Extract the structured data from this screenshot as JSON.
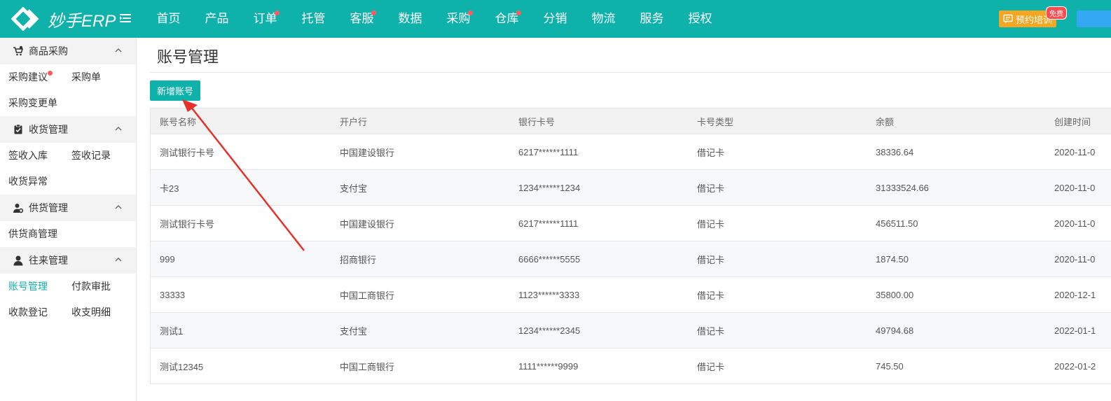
{
  "brand": {
    "name": "妙手ERP"
  },
  "nav": [
    {
      "label": "首页",
      "dot": false
    },
    {
      "label": "产品",
      "dot": false
    },
    {
      "label": "订单",
      "dot": true
    },
    {
      "label": "托管",
      "dot": false
    },
    {
      "label": "客服",
      "dot": true
    },
    {
      "label": "数据",
      "dot": false
    },
    {
      "label": "采购",
      "dot": true
    },
    {
      "label": "仓库",
      "dot": true
    },
    {
      "label": "分销",
      "dot": false
    },
    {
      "label": "物流",
      "dot": false
    },
    {
      "label": "服务",
      "dot": false
    },
    {
      "label": "授权",
      "dot": false
    }
  ],
  "topright": {
    "train_label": "预约培训",
    "free_badge": "免费"
  },
  "sidebar": {
    "sections": [
      {
        "title": "商品采购",
        "icon": "cart-icon",
        "links": [
          {
            "label": "采购建议",
            "dot": true
          },
          {
            "label": "采购单"
          },
          {
            "label": "采购变更单"
          }
        ]
      },
      {
        "title": "收货管理",
        "icon": "clipboard-check-icon",
        "links": [
          {
            "label": "签收入库"
          },
          {
            "label": "签收记录"
          },
          {
            "label": "收货异常"
          }
        ]
      },
      {
        "title": "供货管理",
        "icon": "user-gear-icon",
        "links": [
          {
            "label": "供货商管理"
          }
        ]
      },
      {
        "title": "往来管理",
        "icon": "user-icon",
        "links": [
          {
            "label": "账号管理",
            "active": true
          },
          {
            "label": "付款审批"
          },
          {
            "label": "收款登记"
          },
          {
            "label": "收支明细"
          }
        ]
      }
    ]
  },
  "page": {
    "title": "账号管理",
    "add_button": "新增账号"
  },
  "table": {
    "headers": [
      "账号名称",
      "开户行",
      "银行卡号",
      "卡号类型",
      "余额",
      "创建时间"
    ],
    "rows": [
      [
        "测试银行卡号",
        "中国建设银行",
        "6217******1111",
        "借记卡",
        "38336.64",
        "2020-11-0"
      ],
      [
        "卡23",
        "支付宝",
        "1234******1234",
        "借记卡",
        "31333524.66",
        "2020-11-0"
      ],
      [
        "测试银行卡号",
        "中国建设银行",
        "6217******1111",
        "借记卡",
        "456511.50",
        "2020-11-0"
      ],
      [
        "999",
        "招商银行",
        "6666******5555",
        "借记卡",
        "1874.50",
        "2020-11-0"
      ],
      [
        "33333",
        "中国工商银行",
        "1123******3333",
        "借记卡",
        "35800.00",
        "2020-12-1"
      ],
      [
        "测试1",
        "支付宝",
        "1234******2345",
        "借记卡",
        "49794.68",
        "2022-01-1"
      ],
      [
        "测试12345",
        "中国工商银行",
        "1111******9999",
        "借记卡",
        "745.50",
        "2022-01-2"
      ]
    ]
  },
  "colors": {
    "brand": "#0fb2ab",
    "dot": "#ff5b5b",
    "train": "#f5a623",
    "arrow": "#e8302a"
  }
}
